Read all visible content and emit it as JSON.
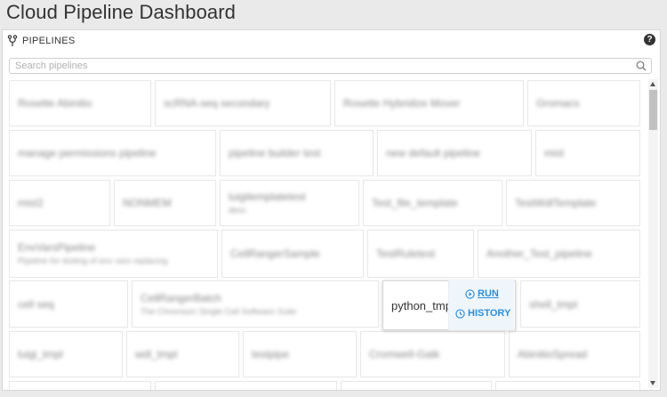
{
  "app": {
    "title": "Cloud Pipeline Dashboard"
  },
  "panel": {
    "icon": "fork-icon",
    "title": "PIPELINES",
    "help_icon": "question-circle-icon",
    "help_glyph": "?"
  },
  "search": {
    "placeholder": "Search pipelines",
    "value": "",
    "icon": "search-icon"
  },
  "pipelines": [
    {
      "name": "Rosette Abinitio",
      "description": ""
    },
    {
      "name": "scRNA-seq secondary",
      "description": ""
    },
    {
      "name": "Rosette Hybridize Mover",
      "description": ""
    },
    {
      "name": "Gromacs",
      "description": ""
    },
    {
      "name": "manage permissions pipeline",
      "description": ""
    },
    {
      "name": "pipeline builder test",
      "description": ""
    },
    {
      "name": "new default pipeline",
      "description": ""
    },
    {
      "name": "mist",
      "description": ""
    },
    {
      "name": "mist2",
      "description": ""
    },
    {
      "name": "NONMEM",
      "description": ""
    },
    {
      "name": "luigitemplatetest",
      "description": "desc"
    },
    {
      "name": "Test_file_template",
      "description": ""
    },
    {
      "name": "TestWdlTemplate",
      "description": ""
    },
    {
      "name": "EnvVarsPipeline",
      "description": "Pipeline for testing of env vars replacing"
    },
    {
      "name": "CellRangerSample",
      "description": ""
    },
    {
      "name": "TestRuletest",
      "description": ""
    },
    {
      "name": "Another_Test_pipeline",
      "description": ""
    },
    {
      "name": "cell seq",
      "description": ""
    },
    {
      "name": "CellRangerBatch",
      "description": "The Chromium Single Cell Software Suite"
    },
    {
      "name": "python_tmpl",
      "description": ""
    },
    {
      "name": "shell_tmpl",
      "description": ""
    },
    {
      "name": "luigi_tmpl",
      "description": ""
    },
    {
      "name": "wdl_tmpl",
      "description": ""
    },
    {
      "name": "testpipe",
      "description": ""
    },
    {
      "name": "Cromwell-Gatk",
      "description": ""
    },
    {
      "name": "AbinitioSpread",
      "description": ""
    }
  ],
  "hovered_pipeline": "python_tmpl",
  "actions": {
    "run_label": "RUN",
    "run_icon": "play-circle-icon",
    "history_label": "HISTORY",
    "history_icon": "history-icon",
    "color": "#2d8fd6"
  }
}
